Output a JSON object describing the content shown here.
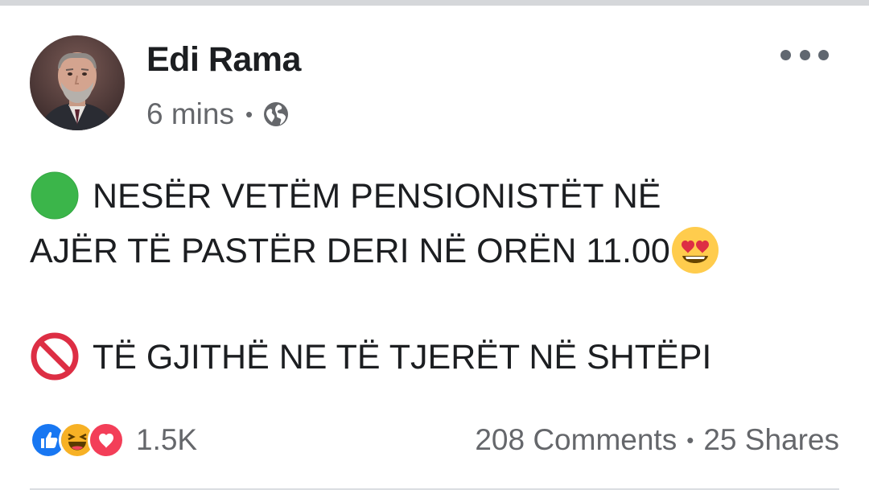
{
  "post": {
    "author": "Edi Rama",
    "time": "6 mins",
    "separator": "•",
    "privacy_icon": "globe-icon",
    "more_icon": "more-options-icon",
    "lines": [
      {
        "emoji": "green-circle-icon",
        "text": "NESËR VETËM PENSIONISTËT NË"
      },
      {
        "text": "AJËR TË PASTËR DERI NË ORËN 11.00",
        "trailing_emoji": "heart-eyes-emoji"
      },
      {
        "emoji": "prohibited-icon",
        "text": "TË GJITHË NE TË TJERËT NË SHTËPI"
      }
    ]
  },
  "footer": {
    "reactions": [
      "like-reaction-icon",
      "haha-reaction-icon",
      "love-reaction-icon"
    ],
    "reaction_count": "1.5K",
    "comments": "208 Comments",
    "separator": "•",
    "shares": "25 Shares"
  },
  "colors": {
    "like": "#1877f2",
    "love": "#f33e58",
    "haha": "#f7b125",
    "green_circle": "#3bb54a",
    "prohibited": "#dd2e44",
    "secondary_text": "#65676b"
  }
}
